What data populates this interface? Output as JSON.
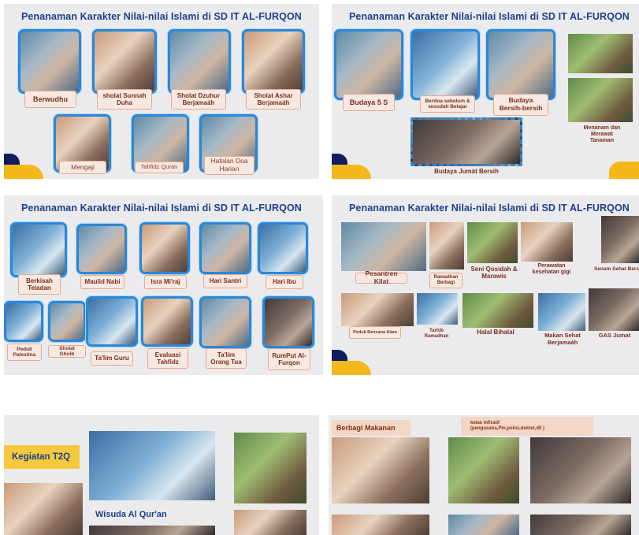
{
  "slide1": {
    "title": "Penanaman Karakter Nilai-nilai Islami di SD IT AL-FURQON",
    "captions": [
      "Berwudhu",
      "sholat Sunnah Duha",
      "Sholat Dzuhur Berjamaáh",
      "Sholat Ashar Berjamaáh",
      "Mengaji",
      "Tahfidz Quran",
      "Hafalan Doa Harian"
    ]
  },
  "slide2": {
    "title": "Penanaman Karakter Nilai-nilai Islami di SD IT AL-FURQON",
    "captions": [
      "Budaya 5 S",
      "Berdoa sebelum & sesudah Belajar",
      "Budaya Bersih-bersih",
      "Menanam dan Merawat Tanaman",
      "Budaya Jumát Bersih"
    ]
  },
  "slide3": {
    "title": "Penanaman Karakter Nilai-nilai Islami di SD IT AL-FURQON",
    "captions": [
      "Berkisah Teladan",
      "Maulid Nabi",
      "Isra Mi'raj",
      "Hari Santri",
      "Hari Ibu",
      "Peduli Palestina",
      "Sholat Ghoib",
      "Ta'lim Guru",
      "Evaluasi Tahfidz",
      "Ta'lim Orang Tua",
      "RumPut Al-Furqon"
    ]
  },
  "slide4": {
    "title": "Penanaman Karakter Nilai-nilai Islami di SD IT AL-FURQON",
    "captions": [
      "Pesantren Kilat",
      "Ramadhan Berbagi",
      "Seni Qosidah & Marawis",
      "Perawatan kesehatan gigi",
      "Senam Sehat Bersama",
      "Peduli Bencana Alam",
      "Tarhib Ramadhan",
      "Halal Bihalal",
      "Makan Sehat Berjamaáh",
      "GAS Jumat"
    ]
  },
  "slide5": {
    "kegiatan": "Kegiatan T2Q",
    "wisuda": "Wisuda Al Qur'an"
  },
  "slide6": {
    "berbagi": "Berbagi Makanan",
    "kelas": "kelas Infiratif\n(pengusaha,Pln,polisi,dokter,dll )"
  },
  "colors": {
    "title": "#1e3f8a",
    "frame": "#2b87d8",
    "accent_yellow": "#f5b81c",
    "accent_navy": "#0f1c5e",
    "caption_bg": "#f7e9e2"
  }
}
